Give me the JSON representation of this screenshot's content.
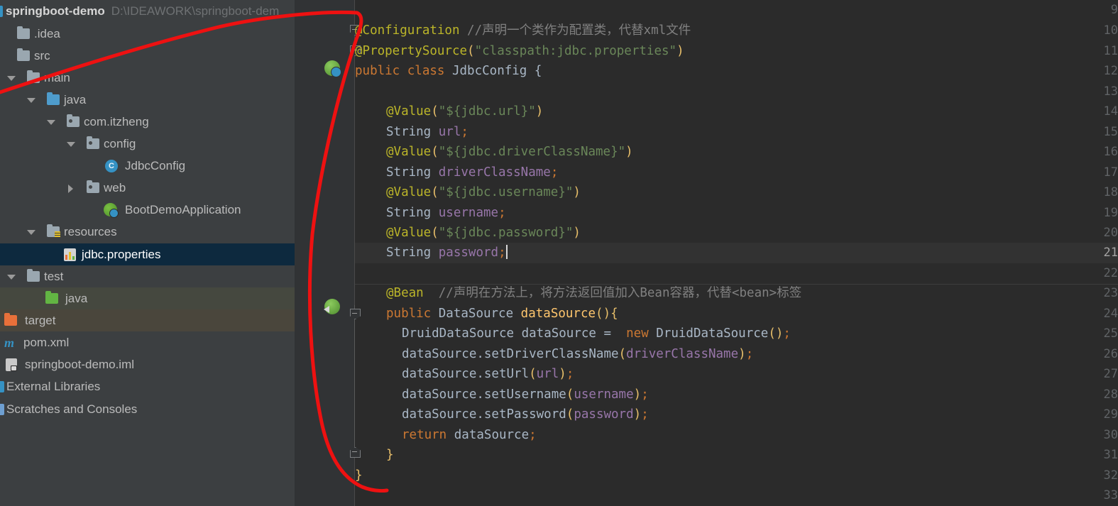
{
  "project": {
    "title_name": "springboot-demo",
    "title_path": "D:\\IDEAWORK\\springboot-dem",
    "items": [
      {
        "label": ".idea",
        "icon": "folder-icon"
      },
      {
        "label": "src",
        "icon": "folder-icon"
      },
      {
        "label": "main",
        "icon": "folder-icon"
      },
      {
        "label": "java",
        "icon": "source-folder-icon"
      },
      {
        "label": "com.itzheng",
        "icon": "package-icon"
      },
      {
        "label": "config",
        "icon": "package-icon"
      },
      {
        "label": "JdbcConfig",
        "icon": "java-class-icon"
      },
      {
        "label": "web",
        "icon": "package-icon"
      },
      {
        "label": "BootDemoApplication",
        "icon": "spring-boot-class-icon"
      },
      {
        "label": "resources",
        "icon": "resources-folder-icon"
      },
      {
        "label": "jdbc.properties",
        "icon": "properties-file-icon"
      },
      {
        "label": "test",
        "icon": "folder-icon"
      },
      {
        "label": "java",
        "icon": "test-source-folder-icon"
      },
      {
        "label": "target",
        "icon": "excluded-folder-icon"
      },
      {
        "label": "pom.xml",
        "icon": "maven-icon"
      },
      {
        "label": "springboot-demo.iml",
        "icon": "module-file-icon"
      },
      {
        "label": "External Libraries",
        "icon": "library-icon"
      },
      {
        "label": "Scratches and Consoles",
        "icon": "scratch-icon"
      }
    ],
    "selected_item": "jdbc.properties"
  },
  "editor": {
    "file": "JdbcConfig",
    "first_line_number": 9,
    "last_line_number": 33,
    "caret_line": 21,
    "line_numbers": [
      "9",
      "10",
      "11",
      "12",
      "13",
      "14",
      "15",
      "16",
      "17",
      "18",
      "19",
      "20",
      "21",
      "22",
      "23",
      "24",
      "25",
      "26",
      "27",
      "28",
      "29",
      "30",
      "31",
      "32",
      "33"
    ],
    "lines": {
      "9": "",
      "10_ann": "@Configuration",
      "10_cmt": " //声明一个类作为配置类，代替xml文件",
      "11_ann": "@PropertySource",
      "11_str": "\"classpath:jdbc.properties\"",
      "12_kw": "public class",
      "12_cls": "JdbcConfig",
      "12_brace": "{",
      "13": "",
      "14_ann": "@Value",
      "14_str": "\"${jdbc.url}\"",
      "15_type": "String",
      "15_fld": "url",
      "16_ann": "@Value",
      "16_str": "\"${jdbc.driverClassName}\"",
      "17_type": "String",
      "17_fld": "driverClassName",
      "18_ann": "@Value",
      "18_str": "\"${jdbc.username}\"",
      "19_type": "String",
      "19_fld": "username",
      "20_ann": "@Value",
      "20_str": "\"${jdbc.password}\"",
      "21_type": "String",
      "21_fld": "password",
      "22": "",
      "23_ann": "@Bean",
      "23_cmt": "  //声明在方法上，将方法返回值加入Bean容器，代替<bean>标签",
      "24_kw": "public",
      "24_cls": "DataSource",
      "24_meth": "dataSource",
      "25_cls": "DruidDataSource",
      "25_var": "dataSource",
      "25_kw": "new",
      "25_ctor": "DruidDataSource",
      "26_call": "dataSource.setDriverClassName",
      "26_arg": "driverClassName",
      "27_call": "dataSource.setUrl",
      "27_arg": "url",
      "28_call": "dataSource.setUsername",
      "28_arg": "username",
      "29_call": "dataSource.setPassword",
      "29_arg": "password",
      "30_kw": "return",
      "30_var": "dataSource",
      "31_brace": "}",
      "32_brace": "}",
      "33": ""
    },
    "gutter_icons": [
      {
        "line": 12,
        "name": "spring-bean-class-gutter-icon"
      },
      {
        "line": 23,
        "name": "spring-bean-method-gutter-icon"
      }
    ]
  },
  "annotation": {
    "name": "red-handdrawn-loop",
    "color": "#ee1111",
    "stroke_width": 5
  },
  "colors": {
    "panel_bg": "#3c3f41",
    "editor_bg": "#2b2b2b",
    "gutter_bg": "#313335",
    "selection_bg": "#0d293e",
    "annotation_yellow": "#bbb529",
    "keyword_orange": "#cc7832",
    "string_green": "#6a8759",
    "field_purple": "#9876aa",
    "method_gold": "#ffc66d",
    "comment_gray": "#808080",
    "text_gray": "#a9b7c6",
    "red_marker": "#ee1111"
  }
}
